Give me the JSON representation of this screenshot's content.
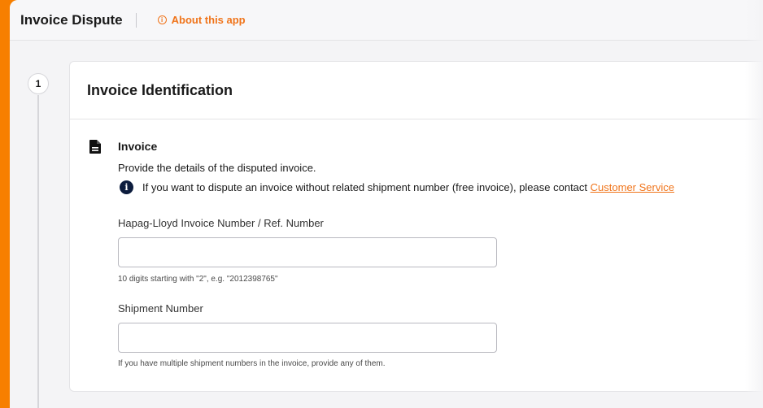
{
  "header": {
    "title": "Invoice Dispute",
    "about_label": "About this app",
    "about_icon": "info-circle-icon"
  },
  "step": {
    "number": "1",
    "title": "Invoice Identification"
  },
  "section": {
    "icon": "document-icon",
    "title": "Invoice",
    "description": "Provide the details of the disputed invoice.",
    "info_icon": "info-icon",
    "info_text": "If you want to dispute an invoice without related shipment number (free invoice), please contact",
    "info_link": "Customer Service"
  },
  "fields": {
    "invoice_number": {
      "label": "Hapag-Lloyd Invoice Number / Ref. Number",
      "value": "",
      "hint": "10 digits starting with \"2\", e.g. \"2012398765\""
    },
    "shipment_number": {
      "label": "Shipment Number",
      "value": "",
      "hint": "If you have multiple shipment numbers in the invoice, provide any of them."
    }
  },
  "colors": {
    "accent": "#f0741a",
    "page_border": "#f77f00",
    "info_icon_bg": "#0c1c3d"
  }
}
